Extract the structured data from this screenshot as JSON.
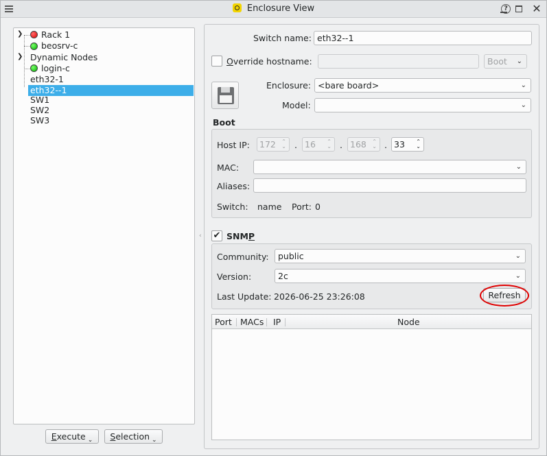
{
  "window": {
    "title": "Enclosure View"
  },
  "tree": {
    "items": [
      {
        "label": "Rack 1",
        "status": "red"
      },
      {
        "label": "beosrv-c",
        "status": "green"
      },
      {
        "label": "Dynamic Nodes"
      },
      {
        "label": "login-c",
        "status": "green"
      },
      {
        "label": "eth32-1"
      },
      {
        "label": "eth32--1",
        "selected": true
      },
      {
        "label": "SW1"
      },
      {
        "label": "SW2"
      },
      {
        "label": "SW3"
      }
    ]
  },
  "buttons": {
    "execute": "Execute",
    "execute_mnemonic": "E",
    "execute_rest": "xecute",
    "selection": "Selection",
    "selection_mnemonic": "S",
    "selection_rest": "election"
  },
  "form": {
    "switch_name_label": "Switch name:",
    "switch_name_value": "eth32--1",
    "override_label": "Override hostname:",
    "override_mnemonic": "O",
    "override_rest": "verride hostname:",
    "override_checked": false,
    "hostname_value": "",
    "boot_combo": "Boot",
    "enclosure_label": "Enclosure:",
    "enclosure_value": "<bare board>",
    "model_label": "Model:",
    "model_value": ""
  },
  "boot": {
    "title": "Boot",
    "host_ip_label": "Host IP:",
    "ip": [
      "172",
      "16",
      "168",
      "33"
    ],
    "mac_label": "MAC:",
    "mac_value": "",
    "aliases_label": "Aliases:",
    "aliases_value": "",
    "switch_label": "Switch:",
    "switch_value": "name",
    "port_label": "Port:",
    "port_value": "0"
  },
  "snmp": {
    "title": "SNMP",
    "title_pre": "SNM",
    "title_mnemonic": "P",
    "checked": true,
    "community_label": "Community:",
    "community_value": "public",
    "version_label": "Version:",
    "version_value": "2c",
    "last_update_label": "Last Update:",
    "last_update_value": "2026-06-25 23:26:08",
    "refresh_label": "Refresh"
  },
  "table": {
    "columns": [
      "Port",
      "MACs",
      "IP",
      "Node"
    ],
    "rows": []
  },
  "icons": {
    "app": "app-logo-icon",
    "save": "floppy-disk-icon",
    "check": "✔",
    "chevron": "⌄"
  },
  "colors": {
    "selection": "#3daee9",
    "status_red": "#e00000",
    "status_green": "#00b000",
    "annotation": "#e00000"
  }
}
